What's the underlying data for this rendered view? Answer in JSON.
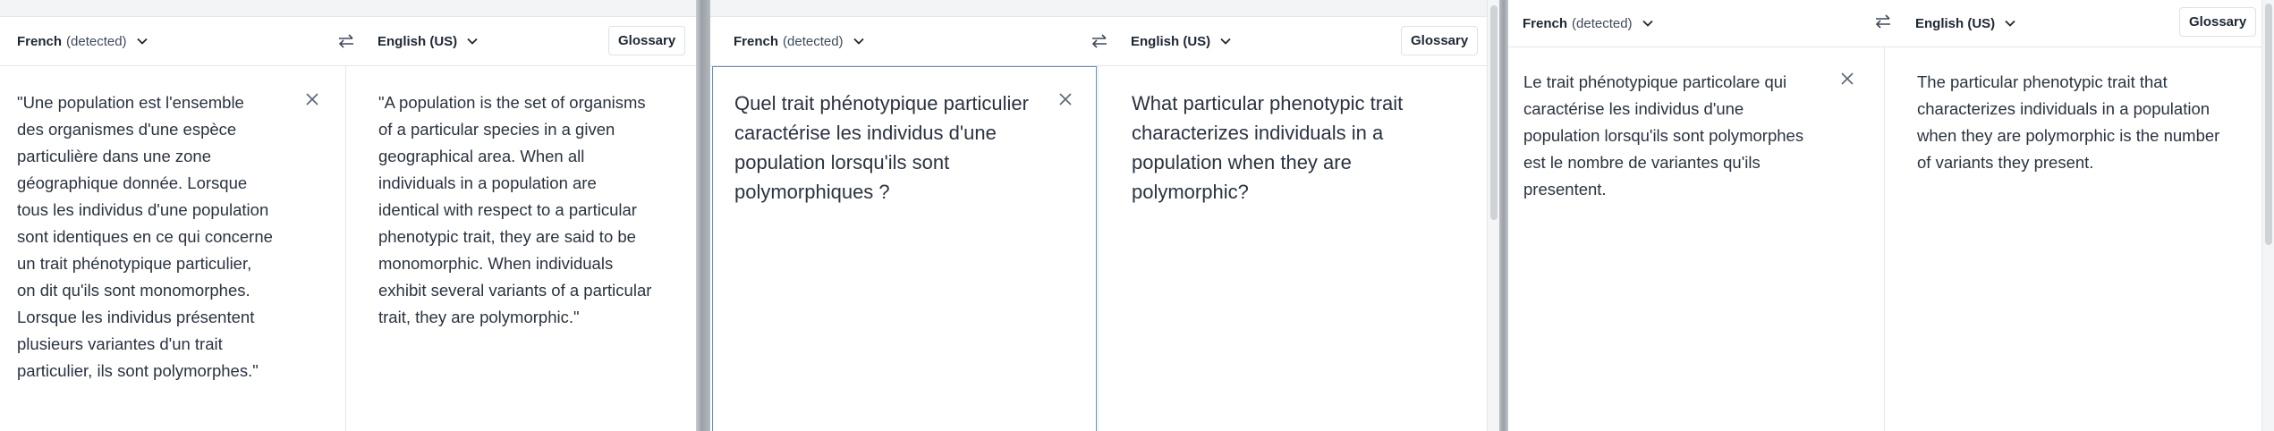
{
  "panels": [
    {
      "source_lang": "French",
      "source_tag": "(detected)",
      "target_lang": "English (US)",
      "glossary": "Glossary",
      "source_text": "\"Une population est l'ensemble\ndes organismes d'une espèce\nparticulière dans une zone\ngéographique donnée. Lorsque\ntous les individus d'une population\nsont identiques en ce qui concerne\nun trait phénotypique particulier,\non dit qu'ils sont monomorphes.\nLorsque les individus présentent\nplusieurs variantes d'un trait\nparticulier, ils sont polymorphes.\"",
      "target_text": "\"A population is the set of organisms\nof a particular species in a given\ngeographical area. When all\nindividuals in a population are\nidentical with respect to a particular\nphenotypic trait, they are said to be\nmonomorphic. When individuals\nexhibit several variants of a particular\ntrait, they are polymorphic.\""
    },
    {
      "source_lang": "French",
      "source_tag": "(detected)",
      "target_lang": "English (US)",
      "glossary": "Glossary",
      "source_text": "Quel trait phénotypique particulier\ncaractérise les individus d'une\npopulation lorsqu'ils sont\npolymorphiques ?",
      "target_text": "What particular phenotypic trait\ncharacterizes individuals in a\npopulation when they are\npolymorphic?"
    },
    {
      "source_lang": "French",
      "source_tag": "(detected)",
      "target_lang": "English (US)",
      "glossary": "Glossary",
      "source_text": "Le trait phénotypique particolare qui\ncaractérise les individus d'une\npopulation lorsqu'ils sont polymorphes\nest le nombre de variantes qu'ils\npresentent.",
      "target_text": "The particular phenotypic trait that\ncharacterizes individuals in a population\nwhen they are polymorphic is the number\nof variants they present."
    }
  ],
  "colors": {
    "focus_border": "#6f8db3",
    "divider": "#e3e6ea",
    "window_shadow": "#9aa0a6",
    "scrollbar": "#d0d3d6"
  }
}
